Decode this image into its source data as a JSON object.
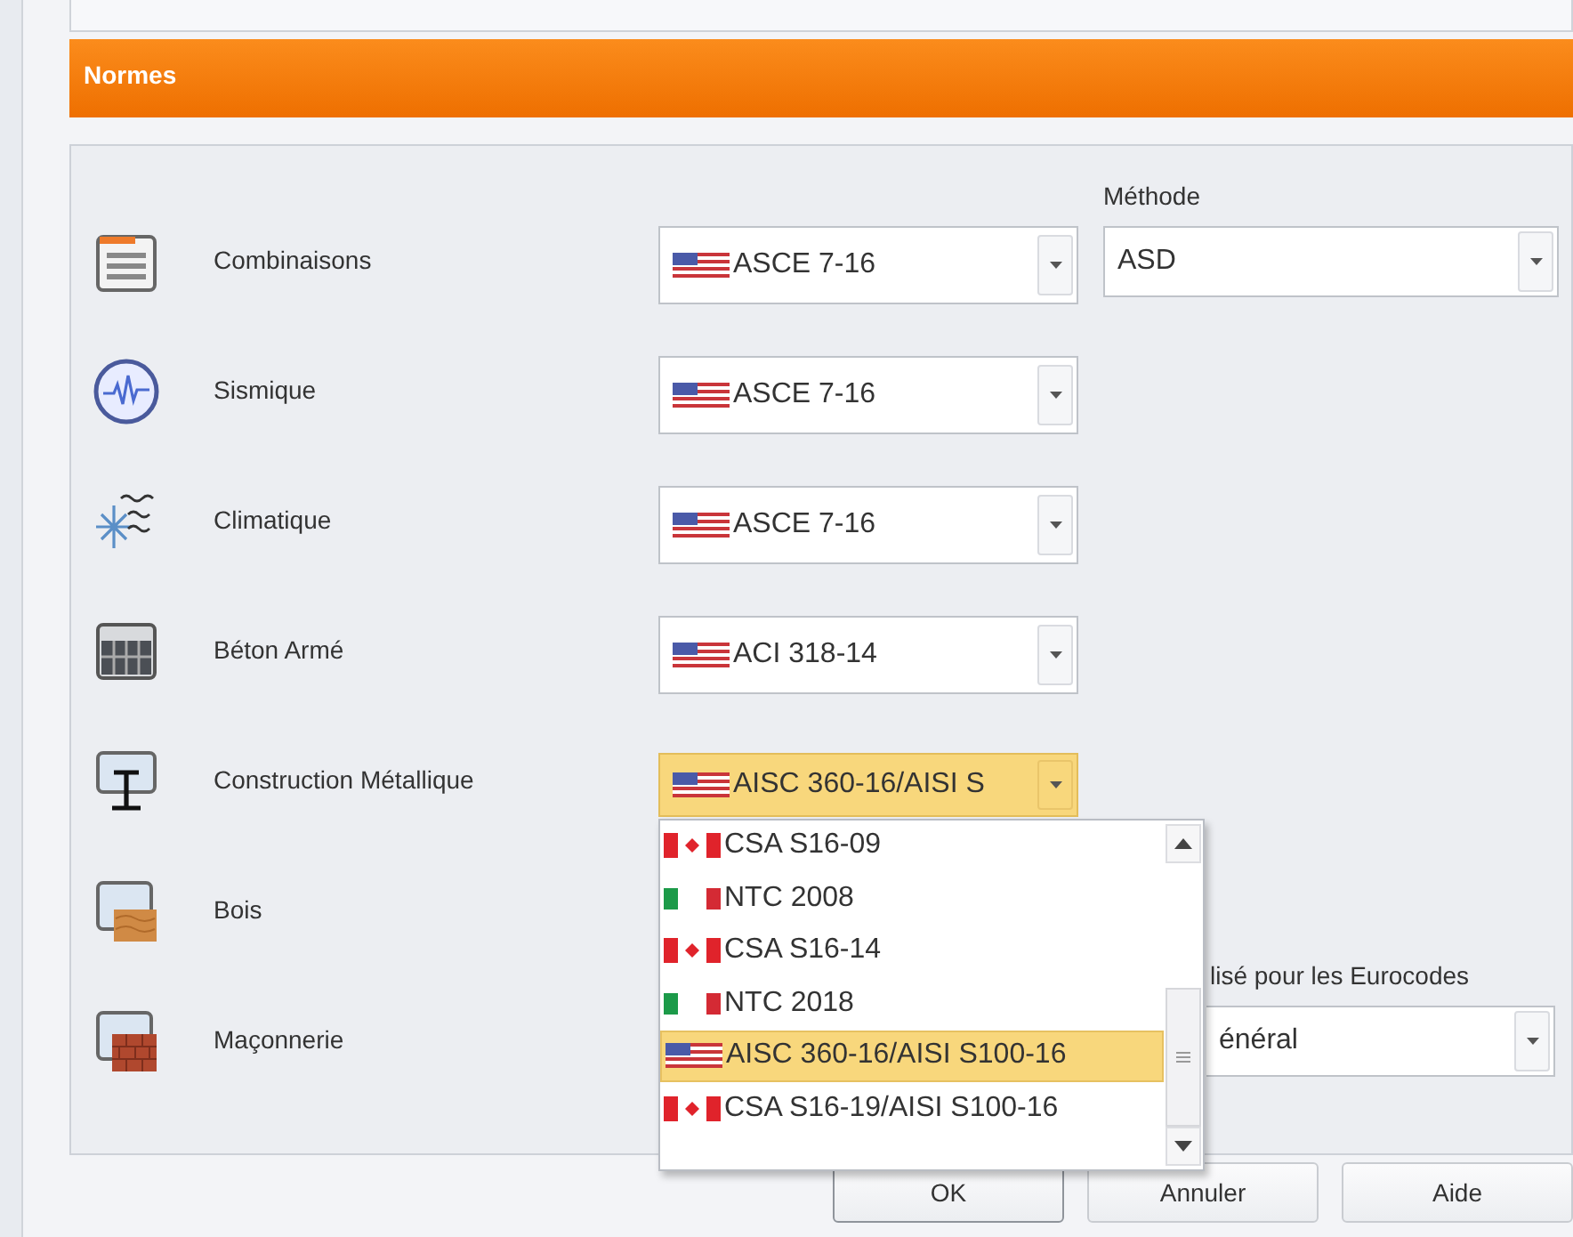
{
  "header": {
    "title": "Normes"
  },
  "standards": [
    {
      "label": "Combinaisons",
      "value": "ASCE 7-16",
      "expanded": false
    },
    {
      "label": "Sismique",
      "value": "ASCE 7-16",
      "expanded": false
    },
    {
      "label": "Climatique",
      "value": "ASCE 7-16",
      "expanded": false
    },
    {
      "label": "Béton Armé",
      "value": "ACI 318-14",
      "expanded": false
    },
    {
      "label": "Construction Métallique",
      "value": "AISC 360-16/AISI S",
      "expanded": true
    },
    {
      "label": "Bois"
    },
    {
      "label": "Maçonnerie"
    }
  ],
  "method": {
    "label": "Méthode",
    "value": "ASD"
  },
  "dropdown": {
    "items": [
      {
        "kind": "canada",
        "text": "CSA S16-09",
        "selected": false
      },
      {
        "kind": "italy",
        "text": "NTC 2008",
        "selected": false
      },
      {
        "kind": "canada",
        "text": "CSA S16-14",
        "selected": false
      },
      {
        "kind": "italy",
        "text": "NTC 2018",
        "selected": false
      },
      {
        "kind": "usa",
        "text": "AISC 360-16/AISI S100-16",
        "selected": true
      },
      {
        "kind": "canada",
        "text": "CSA S16-19/AISI S100-16",
        "selected": false
      }
    ]
  },
  "eurocode": {
    "label": "lisé pour les Eurocodes",
    "value": "énéral"
  },
  "buttons": [
    {
      "label": "OK",
      "default": true
    },
    {
      "label": "Annuler",
      "default": false
    },
    {
      "label": "Aide",
      "default": false
    }
  ]
}
